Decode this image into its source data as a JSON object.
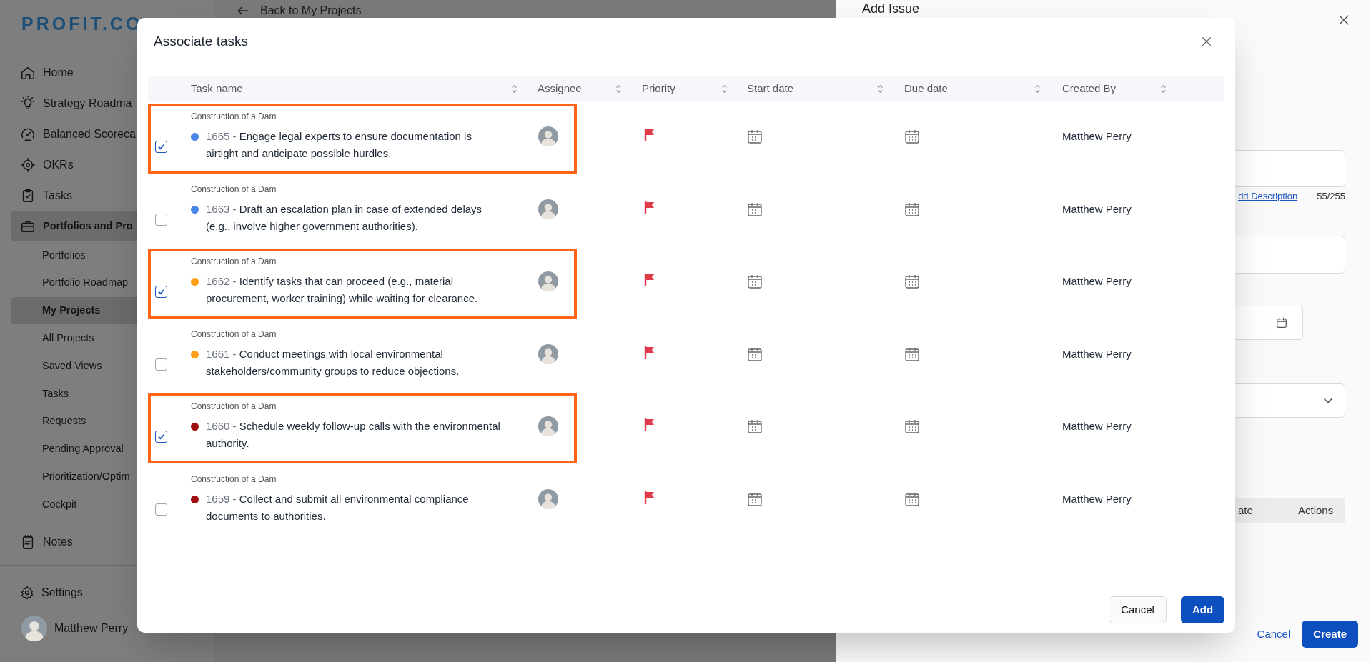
{
  "sidebar": {
    "logo": "PROFIT.CO",
    "items": [
      {
        "label": "Home",
        "selected": false
      },
      {
        "label": "Strategy Roadma",
        "selected": false
      },
      {
        "label": "Balanced Scoreca",
        "selected": false
      },
      {
        "label": "OKRs",
        "selected": false
      },
      {
        "label": "Tasks",
        "selected": false
      },
      {
        "label": "Portfolios and Pro",
        "selected": true,
        "children": [
          {
            "label": "Portfolios",
            "selected": false
          },
          {
            "label": "Portfolio Roadmap",
            "selected": false
          },
          {
            "label": "My Projects",
            "selected": true
          },
          {
            "label": "All Projects",
            "selected": false
          },
          {
            "label": "Saved Views",
            "selected": false
          },
          {
            "label": "Tasks",
            "selected": false
          },
          {
            "label": "Requests",
            "selected": false
          },
          {
            "label": "Pending Approval",
            "selected": false
          },
          {
            "label": "Prioritization/Optim",
            "selected": false
          },
          {
            "label": "Cockpit",
            "selected": false
          }
        ]
      },
      {
        "label": "Notes",
        "selected": false
      }
    ],
    "settings": "Settings",
    "user": "Matthew Perry"
  },
  "main": {
    "back_link": "Back to My Projects"
  },
  "drawer": {
    "title": "Add Issue",
    "description_link": "dd Description",
    "char_count": "55/255",
    "table_columns": [
      "ate",
      "Actions"
    ],
    "cancel": "Cancel",
    "create": "Create"
  },
  "modal": {
    "title": "Associate tasks",
    "columns": [
      "Task name",
      "Assignee",
      "Priority",
      "Start date",
      "Due date",
      "Created By"
    ],
    "rows": [
      {
        "checked": true,
        "highlighted": true,
        "project": "Construction of a Dam",
        "color": "#4a86e8",
        "number": "1665 -",
        "text": "Engage legal experts to ensure documentation is airtight and anticipate possible hurdles.",
        "created_by": "Matthew Perry"
      },
      {
        "checked": false,
        "highlighted": false,
        "project": "Construction of a Dam",
        "color": "#4a86e8",
        "number": "1663 -",
        "text": "Draft an escalation plan in case of extended delays (e.g., involve higher government authorities).",
        "created_by": "Matthew Perry"
      },
      {
        "checked": true,
        "highlighted": true,
        "project": "Construction of a Dam",
        "color": "#ff9f1a",
        "number": "1662 -",
        "text": "Identify tasks that can proceed (e.g., material procurement, worker training) while waiting for clearance.",
        "created_by": "Matthew Perry"
      },
      {
        "checked": false,
        "highlighted": false,
        "project": "Construction of a Dam",
        "color": "#ff9f1a",
        "number": "1661 -",
        "text": "Conduct meetings with local environmental stakeholders/community groups to reduce objections.",
        "created_by": "Matthew Perry"
      },
      {
        "checked": true,
        "highlighted": true,
        "project": "Construction of a Dam",
        "color": "#a00d0d",
        "number": "1660 -",
        "text": "Schedule weekly follow-up calls with the environmental authority.",
        "created_by": "Matthew Perry"
      },
      {
        "checked": false,
        "highlighted": false,
        "project": "Construction of a Dam",
        "color": "#a00d0d",
        "number": "1659 -",
        "text": "Collect and submit all environmental compliance documents to authorities.",
        "created_by": "Matthew Perry"
      }
    ],
    "buttons": [
      "Cancel",
      "Add"
    ]
  }
}
